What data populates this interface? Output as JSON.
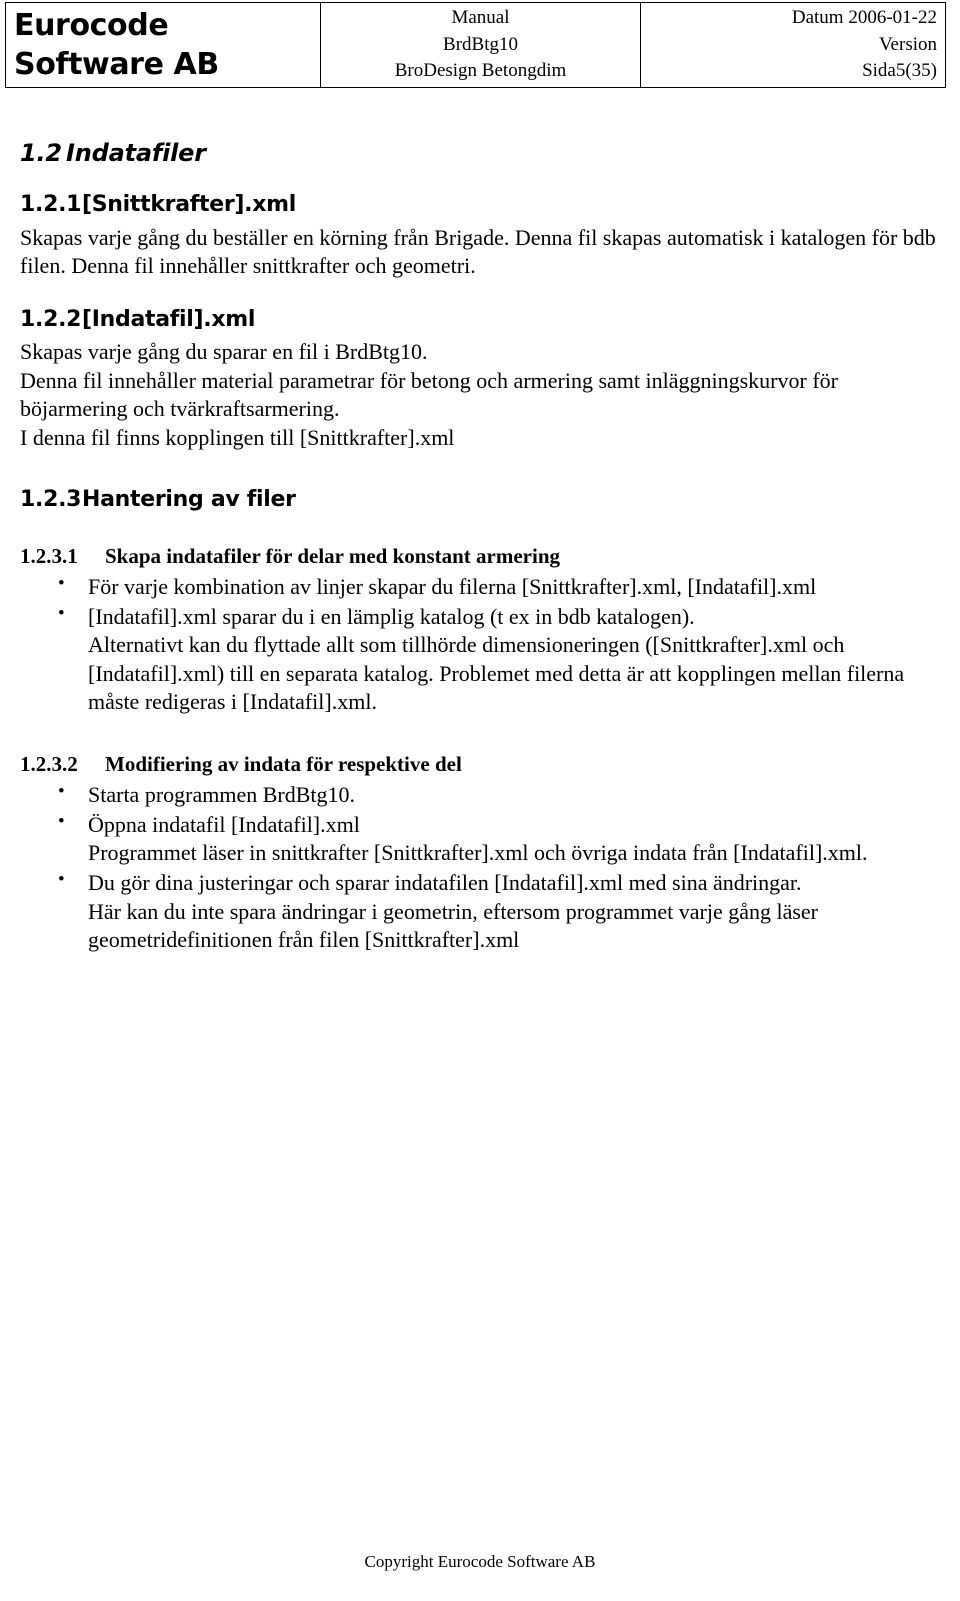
{
  "header": {
    "logo": {
      "line1": "Eurocode",
      "line2": "Software AB"
    },
    "middle": {
      "line1": "Manual",
      "line2": "BrdBtg10",
      "line3": "BroDesign Betongdim"
    },
    "right": {
      "line1": "Datum 2006-01-22",
      "line2": "Version",
      "line3": "Sida5(35)"
    }
  },
  "sections": {
    "s12": {
      "number": "1.2",
      "title": "Indatafiler"
    },
    "s121": {
      "number": "1.2.1",
      "title": "[Snittkrafter].xml",
      "para": "Skapas varje gång du beställer en körning från Brigade. Denna fil skapas automatisk i katalogen för bdb filen. Denna fil innehåller snittkrafter och geometri."
    },
    "s122": {
      "number": "1.2.2",
      "title": "[Indatafil].xml",
      "para1": "Skapas varje gång du sparar en fil i BrdBtg10.",
      "para2": "Denna fil innehåller material parametrar för betong och armering samt inläggningskurvor för böjarmering och tvärkraftsarmering.",
      "para3": "I denna fil finns kopplingen till [Snittkrafter].xml"
    },
    "s123": {
      "number": "1.2.3",
      "title": "Hantering av filer"
    },
    "s1231": {
      "number": "1.2.3.1",
      "title": "Skapa indatafiler för delar med konstant armering",
      "bullets": [
        {
          "main": "För varje kombination av linjer skapar du filerna [Snittkrafter].xml, [Indatafil].xml"
        },
        {
          "main": "[Indatafil].xml sparar du i en lämplig katalog (t ex in bdb katalogen).",
          "cont": "Alternativt kan du flyttade allt som tillhörde dimensioneringen ([Snittkrafter].xml och [Indatafil].xml) till en separata katalog. Problemet med detta är att kopplingen mellan filerna måste redigeras i [Indatafil].xml."
        }
      ]
    },
    "s1232": {
      "number": "1.2.3.2",
      "title": "Modifiering av indata för respektive del",
      "bullets": [
        {
          "main": "Starta programmen BrdBtg10."
        },
        {
          "main": "Öppna indatafil [Indatafil].xml",
          "cont": "Programmet läser in snittkrafter [Snittkrafter].xml och övriga indata från [Indatafil].xml."
        },
        {
          "main": "Du gör dina justeringar och sparar indatafilen [Indatafil].xml med sina ändringar.",
          "cont": "Här kan du inte spara ändringar i geometrin, eftersom programmet varje gång läser geometridefinitionen från filen [Snittkrafter].xml"
        }
      ]
    }
  },
  "footer": {
    "copyright": "Copyright Eurocode Software AB"
  }
}
